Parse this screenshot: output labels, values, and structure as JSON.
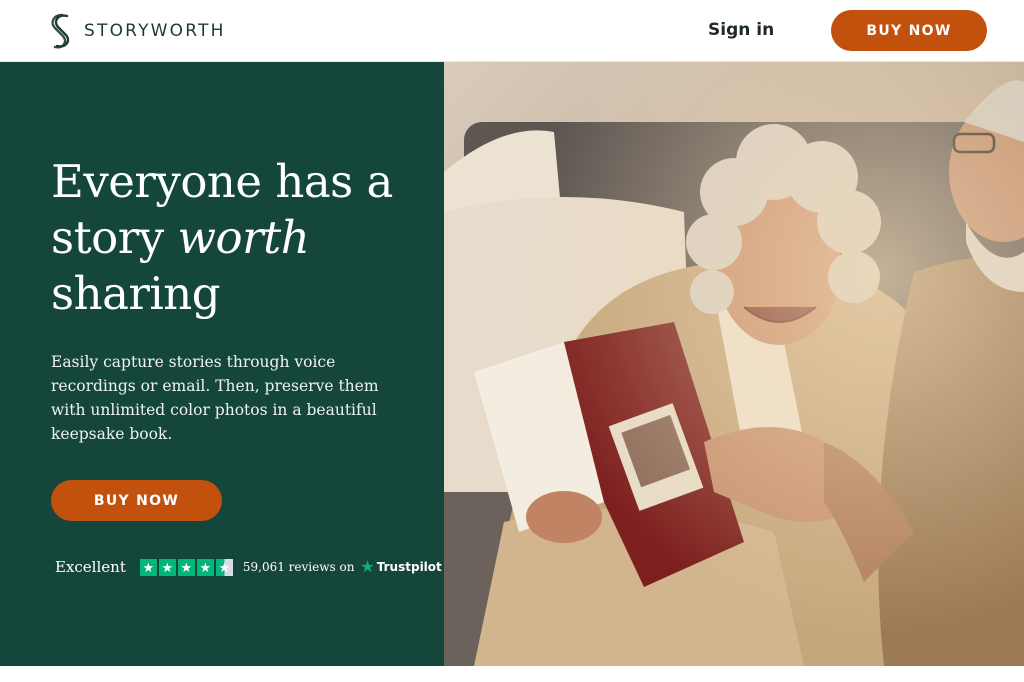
{
  "header": {
    "brand": "STORYWORTH",
    "logo_icon": "storyworth-s-logo-icon",
    "sign_in_label": "Sign in",
    "buy_label": "BUY NOW"
  },
  "hero": {
    "headline_line1": "Everyone has a",
    "headline_story": "story ",
    "headline_worth": "worth",
    "headline_line3": "sharing",
    "subtext": "Easily capture stories through voice recordings or email. Then, preserve them with unlimited color photos in a beautiful keepsake book.",
    "buy_label": "BUY NOW",
    "rating": {
      "word": "Excellent",
      "stars": 4.5,
      "reviews_text": "59,061 reviews on",
      "provider": "Trustpilot"
    }
  },
  "colors": {
    "brand_green": "#15463c",
    "accent_orange": "#c1510c",
    "trustpilot_green": "#00b67a"
  }
}
